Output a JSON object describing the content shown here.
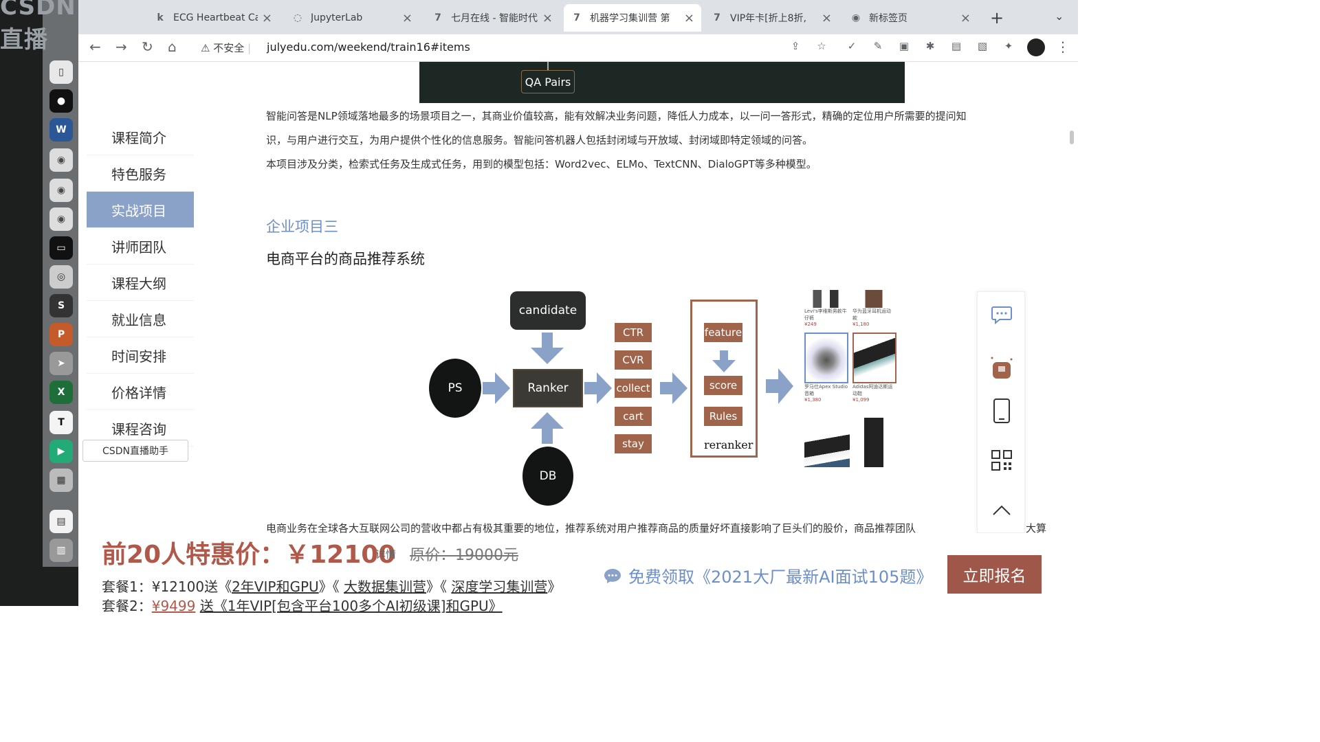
{
  "browser": {
    "dock_title": "CSDN直播",
    "tabs": [
      {
        "label": "ECG Heartbeat Cat",
        "icon": "k"
      },
      {
        "label": "JupyterLab",
        "icon": "loading"
      },
      {
        "label": "七月在线 - 智能时代",
        "icon": "7"
      },
      {
        "label": "机器学习集训营 第",
        "icon": "7"
      },
      {
        "label": "VIP年卡[折上8折,",
        "icon": "7"
      },
      {
        "label": "新标签页",
        "icon": "chrome"
      }
    ],
    "active_tab": 3,
    "insecure_label": "不安全",
    "url": "julyedu.com/weekend/train16#items"
  },
  "sidebar": {
    "items": [
      "课程简介",
      "特色服务",
      "实战项目",
      "讲师团队",
      "课程大纲",
      "就业信息",
      "时间安排",
      "价格详情",
      "课程咨询"
    ],
    "active_index": 2,
    "csdn_badge": "CSDN直播助手"
  },
  "content": {
    "qa_label": "QA Pairs",
    "para1": "智能问答是NLP领域落地最多的场景项目之一，其商业价值较高，能有效解决业务问题，降低人力成本，以一问一答形式，精确的定位用户所需要的提问知",
    "para2": "识，与用户进行交互，为用户提供个性化的信息服务。智能问答机器人包括封闭域与开放域、封闭域即特定领域的问答。",
    "para3": "本项目涉及分类，检索式任务及生成式任务，用到的模型包括：Word2vec、ELMo、TextCNN、DialoGPT等多种模型。",
    "project_tag": "企业项目三",
    "project_title": "电商平台的商品推荐系统",
    "para4": "电商业务在全球各大互联网公司的营收中都占有极其重要的地位，推荐系统对用户推荐商品的质量好坏直接影响了巨头们的股价，商品推荐团队",
    "para4_tail": "大算"
  },
  "diagram": {
    "candidate": "candidate",
    "ps": "PS",
    "ranker": "Ranker",
    "db": "DB",
    "metrics": [
      "CTR",
      "CVR",
      "collect",
      "cart",
      "stay"
    ],
    "feature": "feature",
    "score": "score",
    "rules": "Rules",
    "reranker": "reranker",
    "products": [
      {
        "name": "Levi's李维斯男款牛仔裤",
        "price": "¥249"
      },
      {
        "name": "华为蓝牙耳机运动款",
        "price": "¥1,180"
      },
      {
        "name": "罗马仕Apex Studio音箱",
        "price": "¥1,380"
      },
      {
        "name": "Adidas阿迪达斯运动鞋",
        "price": "¥1,099"
      },
      {
        "name": "",
        "price": ""
      },
      {
        "name": "",
        "price": ""
      }
    ]
  },
  "float_panel": {
    "icons": [
      "chat-icon",
      "gift-icon",
      "phone-icon",
      "qrcode-icon",
      "back-to-top-icon"
    ]
  },
  "pricing": {
    "headline": "前20人特惠价：￥12100",
    "detail_link": "详情",
    "original": "原价：19000元",
    "pkg1_prefix": "套餐1：¥12100送《",
    "pkg1_a": "2年VIP和GPU",
    "pkg1_mid1": "》《",
    "pkg1_b": "大数据集训营",
    "pkg1_mid2": "》《",
    "pkg1_c": "深度学习集训营",
    "pkg1_suffix": "》",
    "pkg2_prefix": "套餐2：",
    "pkg2_price": "¥9499",
    "pkg2_rest": "送《1年VIP[包含平台100多个AI初级课]和GPU》",
    "free_offer": "免费领取《2021大厂最新AI面试105题》",
    "signup": "立即报名"
  },
  "colors": {
    "accent": "#8aa2c8",
    "price": "#b0584a",
    "button": "#9f574a",
    "link": "#6c8fc7",
    "metric_box": "#a0644a",
    "dark_box": "#2b2e2c"
  }
}
